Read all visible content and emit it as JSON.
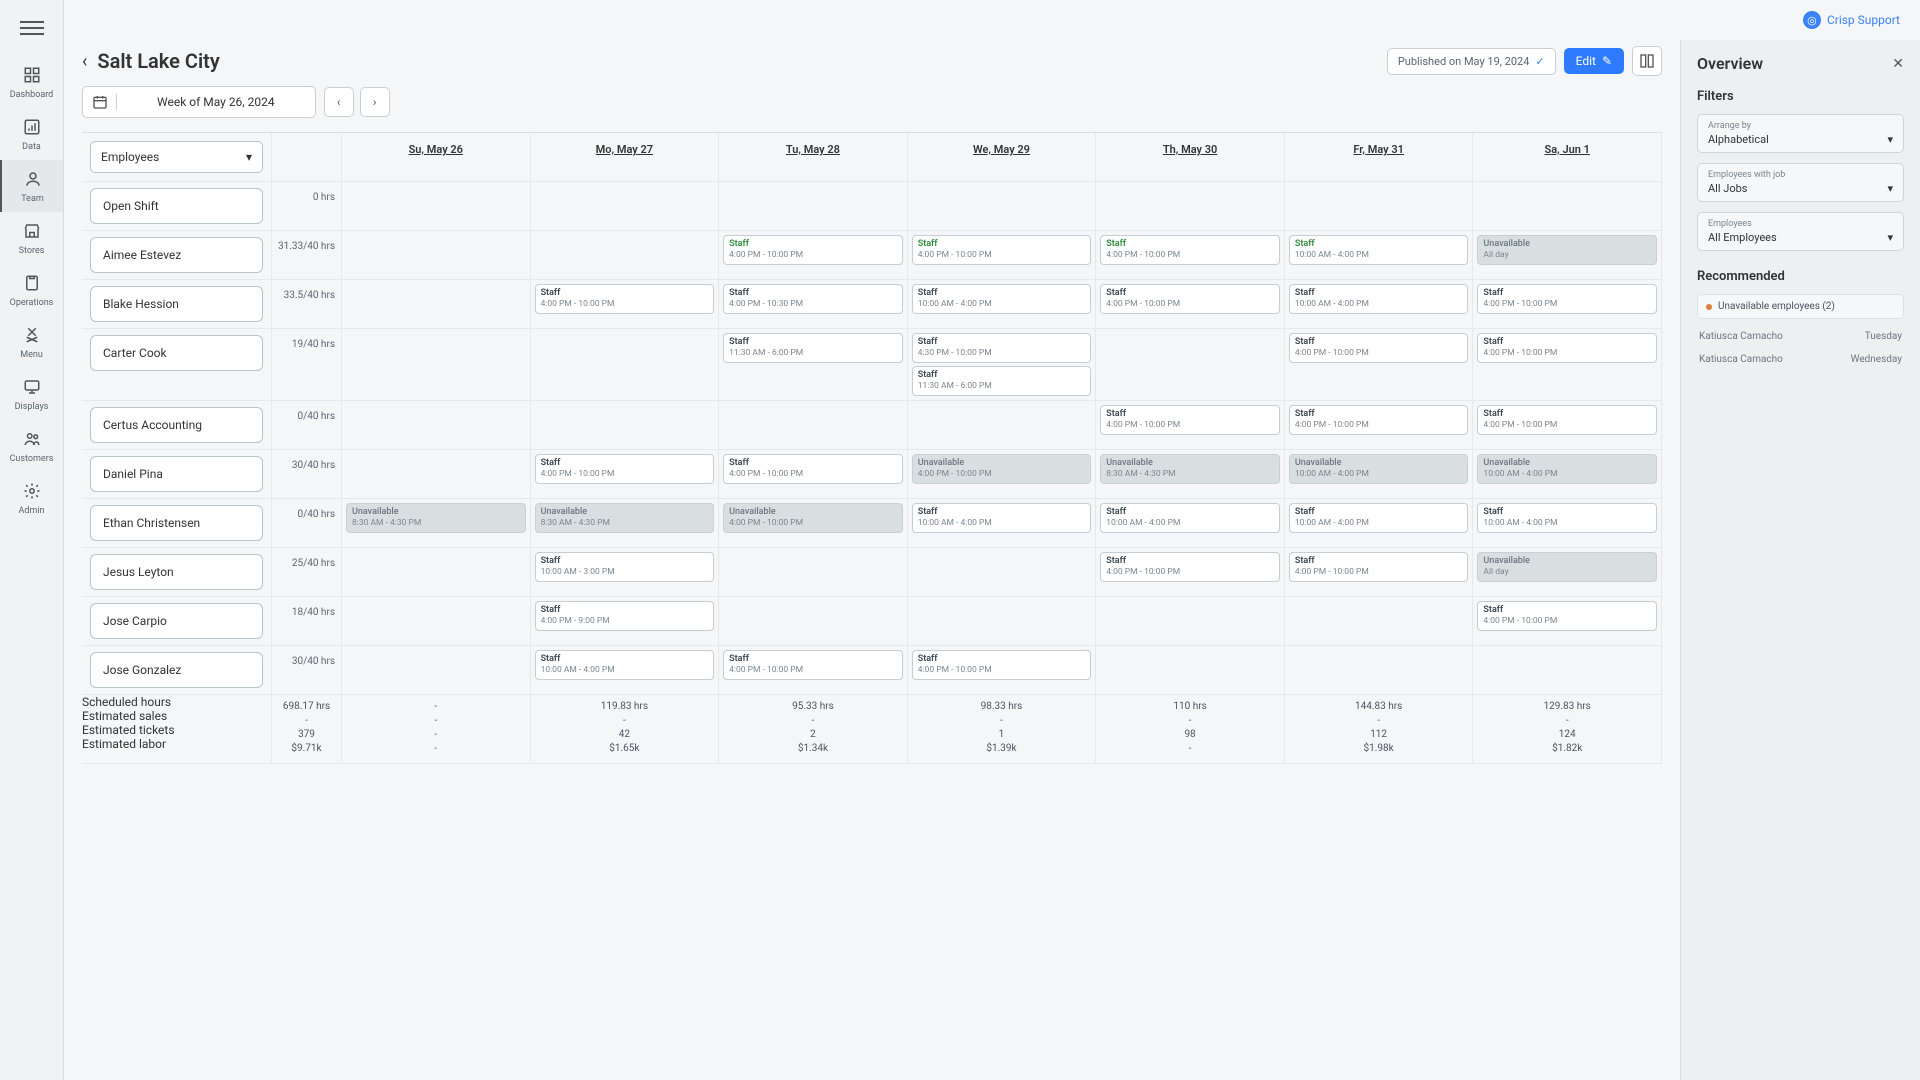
{
  "support": {
    "label": "Crisp Support"
  },
  "sidebar": {
    "items": [
      {
        "label": "Dashboard"
      },
      {
        "label": "Data"
      },
      {
        "label": "Team"
      },
      {
        "label": "Stores"
      },
      {
        "label": "Operations"
      },
      {
        "label": "Menu"
      },
      {
        "label": "Displays"
      },
      {
        "label": "Customers"
      },
      {
        "label": "Admin"
      }
    ]
  },
  "header": {
    "title": "Salt Lake City",
    "published_label": "Published on May 19, 2024",
    "edit_label": "Edit"
  },
  "week": {
    "label": "Week of May 26, 2024"
  },
  "viewSelect": {
    "label": "Employees"
  },
  "days": [
    {
      "label": "Su, May 26"
    },
    {
      "label": "Mo, May 27"
    },
    {
      "label": "Tu, May 28"
    },
    {
      "label": "We, May 29"
    },
    {
      "label": "Th, May 30"
    },
    {
      "label": "Fr, May 31"
    },
    {
      "label": "Sa, Jun 1"
    }
  ],
  "employees": [
    {
      "name": "Open Shift",
      "hours": "0 hrs"
    },
    {
      "name": "Aimee Estevez",
      "hours": "31.33/40 hrs"
    },
    {
      "name": "Blake Hession",
      "hours": "33.5/40 hrs"
    },
    {
      "name": "Carter Cook",
      "hours": "19/40 hrs"
    },
    {
      "name": "Certus Accounting",
      "hours": "0/40 hrs"
    },
    {
      "name": "Daniel Pina",
      "hours": "30/40 hrs"
    },
    {
      "name": "Ethan Christensen",
      "hours": "0/40 hrs"
    },
    {
      "name": "Jesus Leyton",
      "hours": "25/40 hrs"
    },
    {
      "name": "Jose Carpio",
      "hours": "18/40 hrs"
    },
    {
      "name": "Jose Gonzalez",
      "hours": "30/40 hrs"
    }
  ],
  "schedule": [
    [
      [],
      [],
      [],
      [],
      [],
      [],
      []
    ],
    [
      [],
      [],
      [
        {
          "r": "Staff",
          "t": "4:00 PM - 10:00 PM",
          "g": true
        }
      ],
      [
        {
          "r": "Staff",
          "t": "4:00 PM - 10:00 PM",
          "g": true
        }
      ],
      [
        {
          "r": "Staff",
          "t": "4:00 PM - 10:00 PM",
          "g": true
        }
      ],
      [
        {
          "r": "Staff",
          "t": "10:00 AM - 4:00 PM",
          "g": true
        }
      ],
      [
        {
          "r": "Unavailable",
          "u": true,
          "t": "All day"
        }
      ]
    ],
    [
      [],
      [
        {
          "r": "Staff",
          "t": "4:00 PM - 10:00 PM"
        }
      ],
      [
        {
          "r": "Staff",
          "t": "4:00 PM - 10:30 PM"
        }
      ],
      [
        {
          "r": "Staff",
          "t": "10:00 AM - 4:00 PM"
        }
      ],
      [
        {
          "r": "Staff",
          "t": "4:00 PM - 10:00 PM"
        }
      ],
      [
        {
          "r": "Staff",
          "t": "10:00 AM - 4:00 PM"
        }
      ],
      [
        {
          "r": "Staff",
          "t": "4:00 PM - 10:00 PM"
        }
      ]
    ],
    [
      [],
      [],
      [
        {
          "r": "Staff",
          "t": "11:30 AM - 6:00 PM"
        }
      ],
      [
        {
          "r": "Staff",
          "t": "4:30 PM - 10:00 PM"
        },
        {
          "r": "Staff",
          "t": "11:30 AM - 6:00 PM"
        }
      ],
      [],
      [
        {
          "r": "Staff",
          "t": "4:00 PM - 10:00 PM"
        }
      ],
      [
        {
          "r": "Staff",
          "t": "4:00 PM - 10:00 PM"
        }
      ]
    ],
    [
      [],
      [],
      [],
      [],
      [
        {
          "r": "Staff",
          "t": "4:00 PM - 10:00 PM"
        }
      ],
      [
        {
          "r": "Staff",
          "t": "4:00 PM - 10:00 PM"
        }
      ],
      [
        {
          "r": "Staff",
          "t": "4:00 PM - 10:00 PM"
        }
      ]
    ],
    [
      [],
      [
        {
          "r": "Staff",
          "t": "4:00 PM - 10:00 PM"
        }
      ],
      [
        {
          "r": "Staff",
          "t": "4:00 PM - 10:00 PM"
        }
      ],
      [
        {
          "r": "Unavailable",
          "u": true,
          "t": "4:00 PM - 10:00 PM"
        }
      ],
      [
        {
          "r": "Unavailable",
          "u": true,
          "t": "8:30 AM - 4:30 PM"
        }
      ],
      [
        {
          "r": "Unavailable",
          "u": true,
          "t": "10:00 AM - 4:00 PM"
        }
      ],
      [
        {
          "r": "Unavailable",
          "u": true,
          "t": "10:00 AM - 4:00 PM"
        }
      ]
    ],
    [
      [
        {
          "r": "Unavailable",
          "u": true,
          "t": "8:30 AM - 4:30 PM"
        }
      ],
      [
        {
          "r": "Unavailable",
          "u": true,
          "t": "8:30 AM - 4:30 PM"
        }
      ],
      [
        {
          "r": "Unavailable",
          "u": true,
          "t": "4:00 PM - 10:00 PM"
        }
      ],
      [
        {
          "r": "Staff",
          "t": "10:00 AM - 4:00 PM"
        }
      ],
      [
        {
          "r": "Staff",
          "t": "10:00 AM - 4:00 PM"
        }
      ],
      [
        {
          "r": "Staff",
          "t": "10:00 AM - 4:00 PM"
        }
      ],
      [
        {
          "r": "Staff",
          "t": "10:00 AM - 4:00 PM"
        }
      ]
    ],
    [
      [],
      [
        {
          "r": "Staff",
          "t": "10:00 AM - 3:00 PM"
        }
      ],
      [],
      [],
      [
        {
          "r": "Staff",
          "t": "4:00 PM - 10:00 PM"
        }
      ],
      [
        {
          "r": "Staff",
          "t": "4:00 PM - 10:00 PM"
        }
      ],
      [
        {
          "r": "Unavailable",
          "u": true,
          "t": "All day"
        }
      ]
    ],
    [
      [],
      [
        {
          "r": "Staff",
          "t": "4:00 PM - 9:00 PM"
        }
      ],
      [],
      [],
      [],
      [],
      [
        {
          "r": "Staff",
          "t": "4:00 PM - 10:00 PM"
        }
      ]
    ],
    [
      [],
      [
        {
          "r": "Staff",
          "t": "10:00 AM - 4:00 PM"
        }
      ],
      [
        {
          "r": "Staff",
          "t": "4:00 PM - 10:00 PM"
        }
      ],
      [
        {
          "r": "Staff",
          "t": "4:00 PM - 10:00 PM"
        }
      ],
      [],
      [],
      []
    ]
  ],
  "totalsLabels": {
    "scheduled": "Scheduled hours",
    "sales": "Estimated sales",
    "tickets": "Estimated tickets",
    "labor": "Estimated labor"
  },
  "totalsSummary": {
    "hours": "698.17 hrs",
    "sales": "-",
    "tickets": "379",
    "labor": "$9.71k"
  },
  "dayTotals": [
    {
      "hours": "-",
      "sales": "-",
      "tickets": "-",
      "labor": "-"
    },
    {
      "hours": "119.83 hrs",
      "sales": "-",
      "tickets": "42",
      "labor": "$1.65k"
    },
    {
      "hours": "95.33 hrs",
      "sales": "-",
      "tickets": "2",
      "labor": "$1.34k"
    },
    {
      "hours": "98.33 hrs",
      "sales": "-",
      "tickets": "1",
      "labor": "$1.39k"
    },
    {
      "hours": "110 hrs",
      "sales": "-",
      "tickets": "98",
      "labor": "-"
    },
    {
      "hours": "144.83 hrs",
      "sales": "-",
      "tickets": "112",
      "labor": "$1.98k"
    },
    {
      "hours": "129.83 hrs",
      "sales": "-",
      "tickets": "124",
      "labor": "$1.82k"
    }
  ],
  "panel": {
    "title": "Overview",
    "filtersTitle": "Filters",
    "filters": [
      {
        "label": "Arrange by",
        "value": "Alphabetical"
      },
      {
        "label": "Employees with job",
        "value": "All Jobs"
      },
      {
        "label": "Employees",
        "value": "All Employees"
      }
    ],
    "recommendedTitle": "Recommended",
    "recHeader": "Unavailable employees (2)",
    "recItems": [
      {
        "name": "Katiusca Camacho",
        "day": "Tuesday"
      },
      {
        "name": "Katiusca Camacho",
        "day": "Wednesday"
      }
    ]
  }
}
